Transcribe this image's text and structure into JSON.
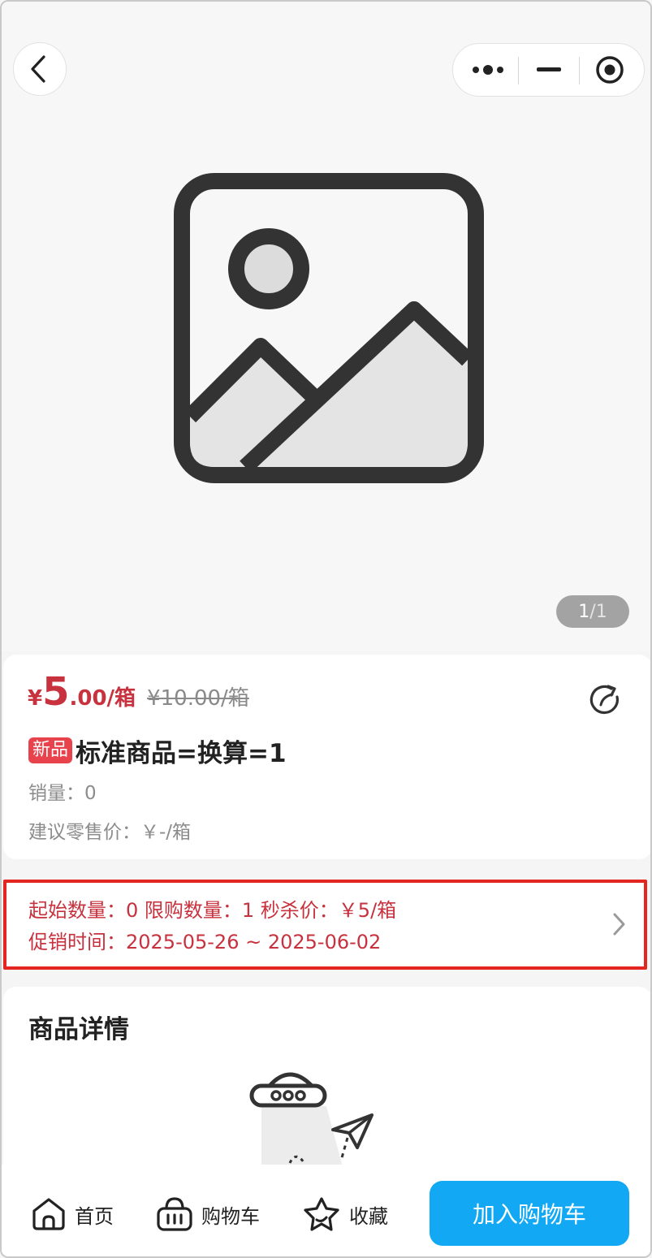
{
  "header": {
    "back_icon": "chevron-left-icon",
    "capsule_icons": [
      "more-dots-icon",
      "minimize-icon",
      "target-close-icon"
    ]
  },
  "gallery": {
    "current": "1",
    "separator": "/",
    "total": "1",
    "image_icon": "image-placeholder-icon"
  },
  "product": {
    "currency": "¥",
    "price_integer": "5",
    "price_decimal": ".00/箱",
    "original_price": "¥10.00/箱",
    "tag": "新品",
    "title": "标准商品=换算=1",
    "sales": "销量：0",
    "suggested_retail": "建议零售价：￥-/箱",
    "share_icon": "share-icon"
  },
  "promotion": {
    "line1": "起始数量：0 限购数量：1 秒杀价：￥5/箱",
    "line2": "促销时间：2025-05-26 ~ 2025-06-02",
    "highlight_color": "#e3261f"
  },
  "details": {
    "title": "商品详情"
  },
  "bottom_nav": {
    "home": "首页",
    "cart": "购物车",
    "favorite": "收藏",
    "add_to_cart": "加入购物车"
  },
  "colors": {
    "price_red": "#c7323e",
    "tag_red": "#e8424c",
    "primary_blue": "#12a8f3"
  }
}
